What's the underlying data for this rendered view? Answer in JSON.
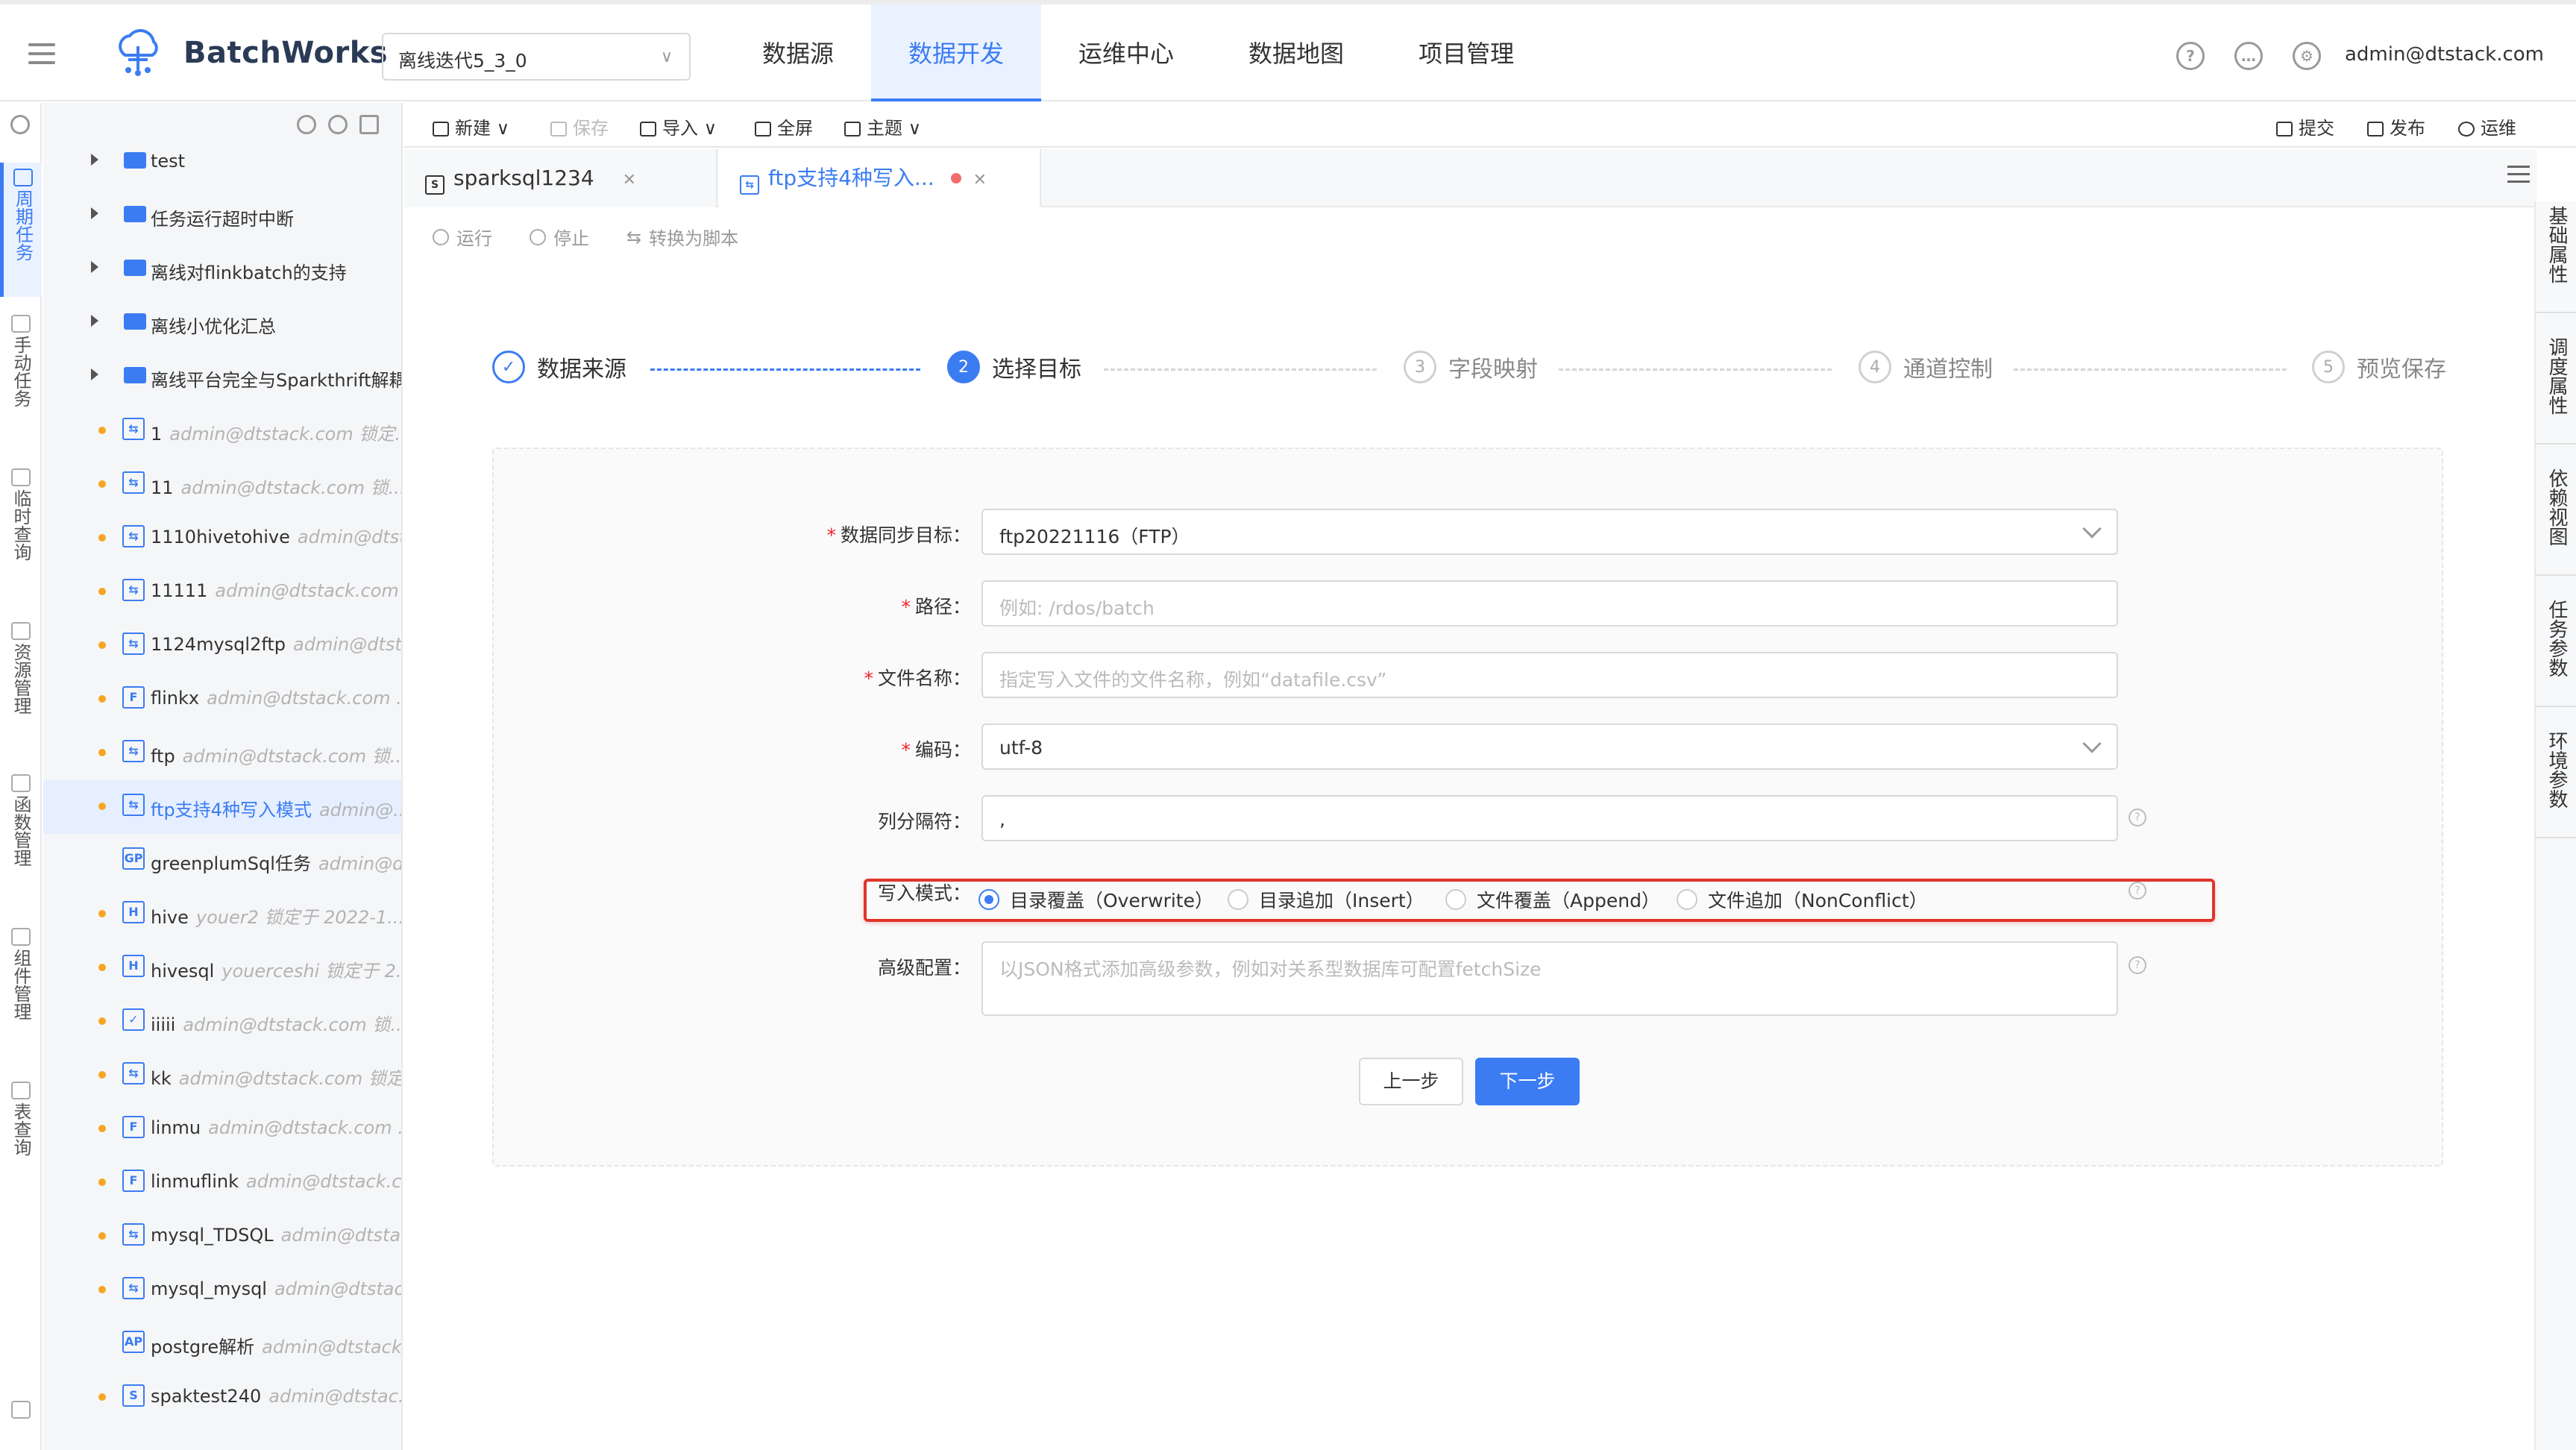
{
  "app": {
    "name": "BatchWorks",
    "project": "离线迭代5_3_0",
    "user": "admin@dtstack.com"
  },
  "nav": [
    "数据源",
    "数据开发",
    "运维中心",
    "数据地图",
    "项目管理"
  ],
  "rail": [
    "周期任务",
    "手动任务",
    "临时查询",
    "资源管理",
    "函数管理",
    "组件管理",
    "表查询"
  ],
  "tree": [
    {
      "type": "folder",
      "label": "test",
      "meta": ""
    },
    {
      "type": "folder",
      "label": "任务运行超时中断",
      "meta": ""
    },
    {
      "type": "folder",
      "label": "离线对flinkbatch的支持",
      "meta": ""
    },
    {
      "type": "folder",
      "label": "离线小优化汇总",
      "meta": ""
    },
    {
      "type": "folder",
      "label": "离线平台完全与Sparkthrift解耦",
      "meta": ""
    },
    {
      "type": "file",
      "icon": "⇆",
      "label": "1",
      "meta": "admin@dtstack.com 锁定..."
    },
    {
      "type": "file",
      "icon": "⇆",
      "label": "11",
      "meta": "admin@dtstack.com 锁..."
    },
    {
      "type": "file",
      "icon": "⇆",
      "label": "1110hivetohive",
      "meta": "admin@dtst..."
    },
    {
      "type": "file",
      "icon": "⇆",
      "label": "11111",
      "meta": "admin@dtstack.com"
    },
    {
      "type": "file",
      "icon": "⇆",
      "label": "1124mysql2ftp",
      "meta": "admin@dtst..."
    },
    {
      "type": "file",
      "icon": "F",
      "label": "flinkx",
      "meta": "admin@dtstack.com ..."
    },
    {
      "type": "file",
      "icon": "⇆",
      "label": "ftp",
      "meta": "admin@dtstack.com 锁..."
    },
    {
      "type": "file",
      "icon": "⇆",
      "label": "ftp支持4种写入模式",
      "meta": "admin@...",
      "selected": true
    },
    {
      "type": "file",
      "icon": "GP",
      "label": "greenplumSql任务",
      "meta": "admin@d...",
      "nodot": true
    },
    {
      "type": "file",
      "icon": "H",
      "label": "hive",
      "meta": "youer2 锁定于 2022-1..."
    },
    {
      "type": "file",
      "icon": "H",
      "label": "hivesql",
      "meta": "youerceshi 锁定于 2..."
    },
    {
      "type": "file",
      "icon": "✓",
      "label": "iiiii",
      "meta": "admin@dtstack.com 锁..."
    },
    {
      "type": "file",
      "icon": "⇆",
      "label": "kk",
      "meta": "admin@dtstack.com 锁定..."
    },
    {
      "type": "file",
      "icon": "F",
      "label": "linmu",
      "meta": "admin@dtstack.com ..."
    },
    {
      "type": "file",
      "icon": "F",
      "label": "linmuflink",
      "meta": "admin@dtstack.c..."
    },
    {
      "type": "file",
      "icon": "⇆",
      "label": "mysql_TDSQL",
      "meta": "admin@dtsta..."
    },
    {
      "type": "file",
      "icon": "⇆",
      "label": "mysql_mysql",
      "meta": "admin@dtstac..."
    },
    {
      "type": "file",
      "icon": "AP",
      "label": "postgre解析",
      "meta": "admin@dtstack...",
      "nodot": true
    },
    {
      "type": "file",
      "icon": "S",
      "label": "spaktest240",
      "meta": "admin@dtstac..."
    }
  ],
  "toolbar": {
    "new": "新建",
    "save": "保存",
    "import": "导入",
    "fullscreen": "全屏",
    "theme": "主题",
    "submit": "提交",
    "publish": "发布",
    "ops": "运维"
  },
  "tabs": [
    {
      "label": "sparksql1234",
      "icon": "S"
    },
    {
      "label": "ftp支持4种写入...",
      "icon": "⇆",
      "active": true
    }
  ],
  "actions": {
    "run": "运行",
    "stop": "停止",
    "convert": "转换为脚本"
  },
  "steps": [
    {
      "num": "✓",
      "label": "数据来源"
    },
    {
      "num": "2",
      "label": "选择目标"
    },
    {
      "num": "3",
      "label": "字段映射"
    },
    {
      "num": "4",
      "label": "通道控制"
    },
    {
      "num": "5",
      "label": "预览保存"
    }
  ],
  "form": {
    "target_label": "数据同步目标：",
    "target_value": "ftp20221116（FTP）",
    "path_label": "路径：",
    "path_placeholder": "例如: /rdos/batch",
    "filename_label": "文件名称：",
    "filename_placeholder": "指定写入文件的文件名称，例如“datafile.csv”",
    "encoding_label": "编码：",
    "encoding_value": "utf-8",
    "delimiter_label": "列分隔符：",
    "delimiter_value": ",",
    "writemode_label": "写入模式：",
    "writemodes": [
      "目录覆盖（Overwrite）",
      "目录追加（Insert）",
      "文件覆盖（Append）",
      "文件追加（NonConflict）"
    ],
    "advanced_label": "高级配置：",
    "advanced_placeholder": "以JSON格式添加高级参数，例如对关系型数据库可配置fetchSize",
    "prev": "上一步",
    "next": "下一步"
  },
  "right_rail": [
    "基础属性",
    "调度属性",
    "依赖视图",
    "任务参数",
    "环境参数"
  ],
  "colors": {
    "primary": "#3b7cf2",
    "highlight": "#e0352b"
  }
}
